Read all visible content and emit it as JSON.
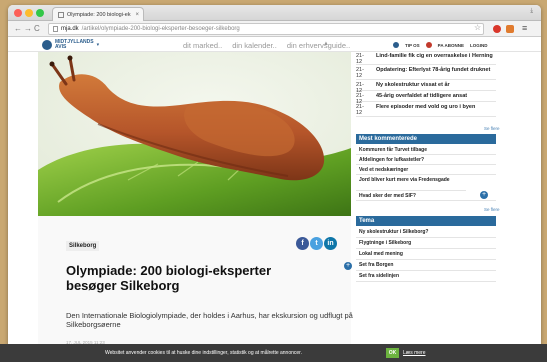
{
  "browser": {
    "tab_title": "Olympiade: 200 biologi-ek",
    "tab_close": "×",
    "user_badge": "⤓",
    "url_host": "mja.dk",
    "url_path": "/artikel/olympiade-200-biologi-eksperter-besoeger-silkeborg",
    "nav_back": "←",
    "nav_forward": "→",
    "nav_reload": "C",
    "star": "☆",
    "menu": "≡"
  },
  "site_header": {
    "logo_text_1": "MIDTJYLLANDS",
    "logo_text_2": "AVIS",
    "logo_caret": "▾",
    "nav_links": [
      "dit marked..",
      "din kalender..",
      "din erhvervsguide.."
    ],
    "nav_caret": "▲",
    "tip_label": "TIP OS",
    "subscribe_label": "PA ABONNE",
    "login_label": "LOGIND"
  },
  "article": {
    "section_tag": "Silkeborg",
    "share": {
      "facebook": "f",
      "twitter": "t",
      "linkedin": "in"
    },
    "headline": "Olympiade: 200 biologi-eksperter besøger Silkeborg",
    "plus_badge": "+",
    "lead": "Den Internationale Biologiolympiade, der holdes i Aarhus, har ekskursion og udflugt på Silkeborgsøerne",
    "byline": "17. JUL 2015 11:23"
  },
  "sidebar": {
    "latest": [
      {
        "date": "21-12",
        "text": "Lind-familie fik cig en overraskelse i Herning"
      },
      {
        "date": "21-12",
        "text": "Opdatering: Efterlyst 78-årig fundet druknet"
      },
      {
        "date": "21-12",
        "text": "Ny skolestruktur vissat et år"
      },
      {
        "date": "21-12",
        "text": "45-årig overfaldet af tidligere ansat"
      },
      {
        "date": "21-12",
        "text": "Flere episoder med vold og uro i byen"
      }
    ],
    "more_label_1": "Se flere",
    "most_commented_title": "Mest kommenterede",
    "most_commented": [
      "Kommuren får Turvet tilbage",
      "Afdelingen for lufkastetler?",
      "Ved et nedskæringer",
      "Jord bliver kurt mere via Fredensgade",
      "Hvad sker der med SIF?"
    ],
    "more_label_2": "Se flere",
    "themes_title": "Tema",
    "themes": [
      "Ny skolestruktur i Silkeborg?",
      "Flygtninge i Silkeborg",
      "Lokal med mening",
      "Set fra Borgen",
      "Set fra sidelinjen"
    ],
    "plus_badge": "+"
  },
  "cookie_bar": {
    "text": "Websitet anvender cookies til at huske dine indstillinger, statistik og at målrette annoncer.",
    "ok_label": "OK",
    "more_label": "Læs mere"
  },
  "colors": {
    "accent_blue": "#2a6a9c",
    "desktop": "#c9a872",
    "cookie_ok": "#6cb33f"
  }
}
